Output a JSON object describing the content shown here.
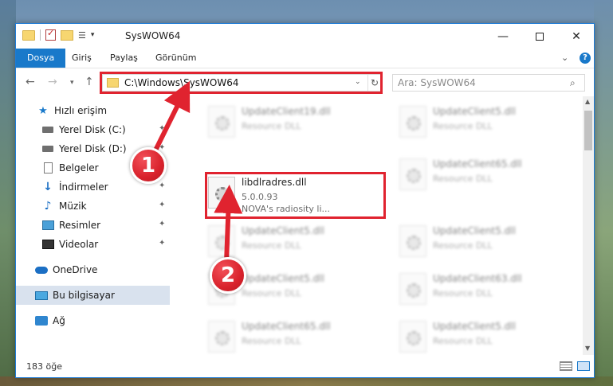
{
  "window": {
    "title": "SysWOW64"
  },
  "quick_access_toolbar": {
    "dropdown_glyph": "▾"
  },
  "ribbon": {
    "tabs": [
      {
        "label": "Dosya",
        "active": true
      },
      {
        "label": "Giriş"
      },
      {
        "label": "Paylaş"
      },
      {
        "label": "Görünüm"
      }
    ],
    "help_glyph": "?"
  },
  "navigation": {
    "address": "C:\\Windows\\SysWOW64",
    "search_placeholder": "Ara: SysWOW64"
  },
  "sidebar": {
    "items": [
      {
        "label": "Hızlı erişim",
        "icon": "star-icon"
      },
      {
        "label": "Yerel Disk (C:)",
        "icon": "drive-icon",
        "pinned": true
      },
      {
        "label": "Yerel Disk (D:)",
        "icon": "drive-icon",
        "pinned": true
      },
      {
        "label": "Belgeler",
        "icon": "document-icon",
        "pinned": true
      },
      {
        "label": "İndirmeler",
        "icon": "download-icon",
        "pinned": true
      },
      {
        "label": "Müzik",
        "icon": "music-icon",
        "pinned": true
      },
      {
        "label": "Resimler",
        "icon": "pictures-icon",
        "pinned": true
      },
      {
        "label": "Videolar",
        "icon": "videos-icon",
        "pinned": true
      },
      {
        "label": "OneDrive",
        "icon": "cloud-icon"
      },
      {
        "label": "Bu bilgisayar",
        "icon": "computer-icon",
        "selected": true
      },
      {
        "label": "Ağ",
        "icon": "network-icon"
      }
    ]
  },
  "files": {
    "background_tiles": [
      {
        "name": "UpdateClient19.dll",
        "type": "Resource DLL"
      },
      {
        "name": "UpdateClient5.dll",
        "type": "Resource DLL"
      },
      {
        "name": "UpdateClient65.dll",
        "type": "Resource DLL"
      },
      {
        "name": "UpdateClient5.dll",
        "type": "Resource DLL"
      },
      {
        "name": "UpdateClient5.dll",
        "type": "Resource DLL"
      },
      {
        "name": "UpdateClient5.dll",
        "type": "Resource DLL"
      },
      {
        "name": "UpdateClient63.dll",
        "type": "Resource DLL"
      },
      {
        "name": "UpdateClient65.dll",
        "type": "Resource DLL"
      },
      {
        "name": "UpdateClient5.dll",
        "type": "Resource DLL"
      }
    ],
    "highlighted": {
      "name": "libdlradres.dll",
      "version": "5.0.0.93",
      "description": "NOVA's radiosity li..."
    }
  },
  "status": {
    "item_count": "183 öğe"
  },
  "annotations": {
    "step1": "1",
    "step2": "2",
    "accent_color": "#e0232f"
  },
  "colors": {
    "ribbon_file_tab": "#1979ca",
    "selection": "#d9e2ee"
  }
}
